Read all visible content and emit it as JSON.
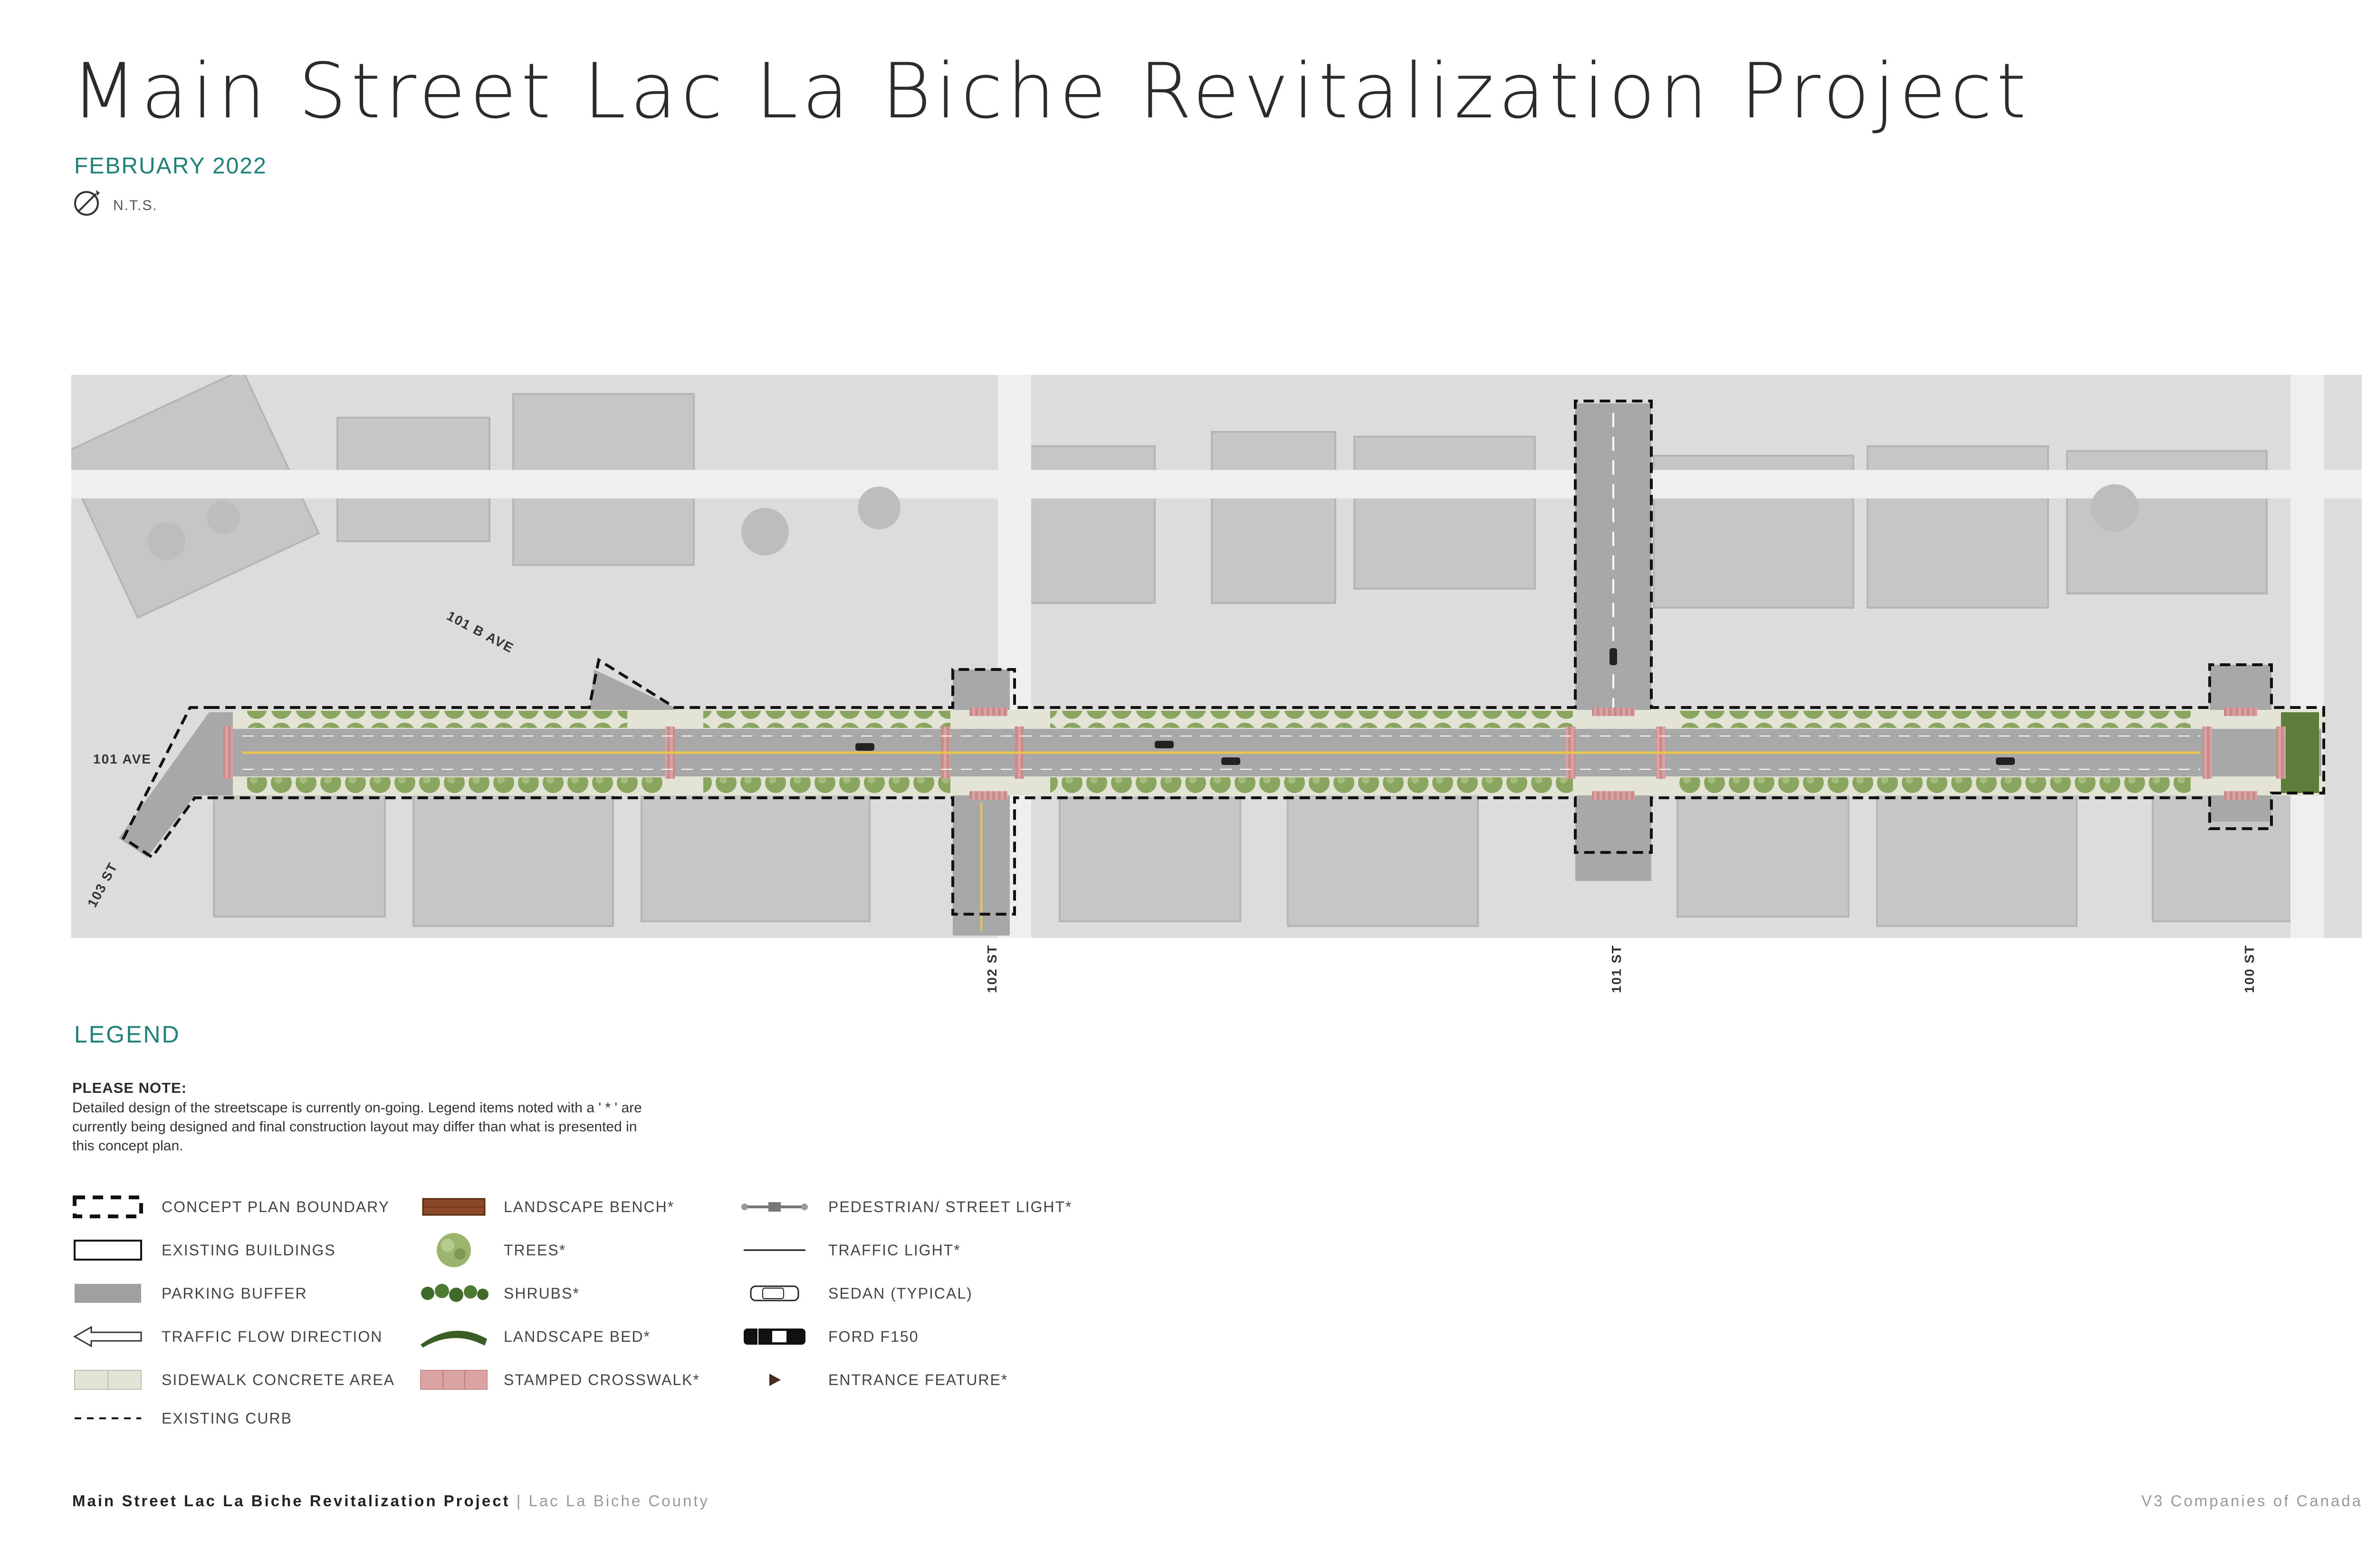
{
  "header": {
    "title": "Main Street Lac La Biche Revitalization Project",
    "date": "FEBRUARY 2022",
    "scale": "N.T.S."
  },
  "map": {
    "streets": {
      "ave_101": "101 AVE",
      "ave_101b": "101 B AVE",
      "st_103": "103 ST",
      "st_102": "102 ST",
      "st_101": "101 ST",
      "st_100": "100 ST"
    }
  },
  "legend": {
    "title": "LEGEND",
    "note_heading": "PLEASE NOTE:",
    "note_body": "Detailed design of the streetscape is currently on-going. Legend items noted with a ' * ' are currently being designed and final construction layout may differ than what is presented in this concept plan.",
    "items": {
      "concept_plan_boundary": "CONCEPT PLAN BOUNDARY",
      "existing_buildings": "EXISTING BUILDINGS",
      "parking_buffer": "PARKING BUFFER",
      "traffic_flow_direction": "TRAFFIC FLOW DIRECTION",
      "sidewalk_concrete_area": "SIDEWALK CONCRETE AREA",
      "existing_curb": "EXISTING CURB",
      "landscape_bench": "LANDSCAPE BENCH*",
      "trees": "TREES*",
      "shrubs": "SHRUBS*",
      "landscape_bed": "LANDSCAPE BED*",
      "stamped_crosswalk": "STAMPED CROSSWALK*",
      "pedestrian_street_light": "PEDESTRIAN/ STREET LIGHT*",
      "traffic_light": "TRAFFIC LIGHT*",
      "sedan": "SEDAN (TYPICAL)",
      "ford_f150": "FORD F150",
      "entrance_feature": "ENTRANCE FEATURE*"
    }
  },
  "footer": {
    "project": "Main Street Lac La Biche Revitalization Project",
    "separator": "|",
    "county": "Lac La Biche County",
    "company": "V3 Companies of Canada"
  },
  "colors": {
    "accent": "#1f8078",
    "crosswalk": "#c98a8a",
    "sidewalk": "#e4e4d6",
    "tree": "#7d9a55",
    "bench": "#8a4a2a"
  }
}
